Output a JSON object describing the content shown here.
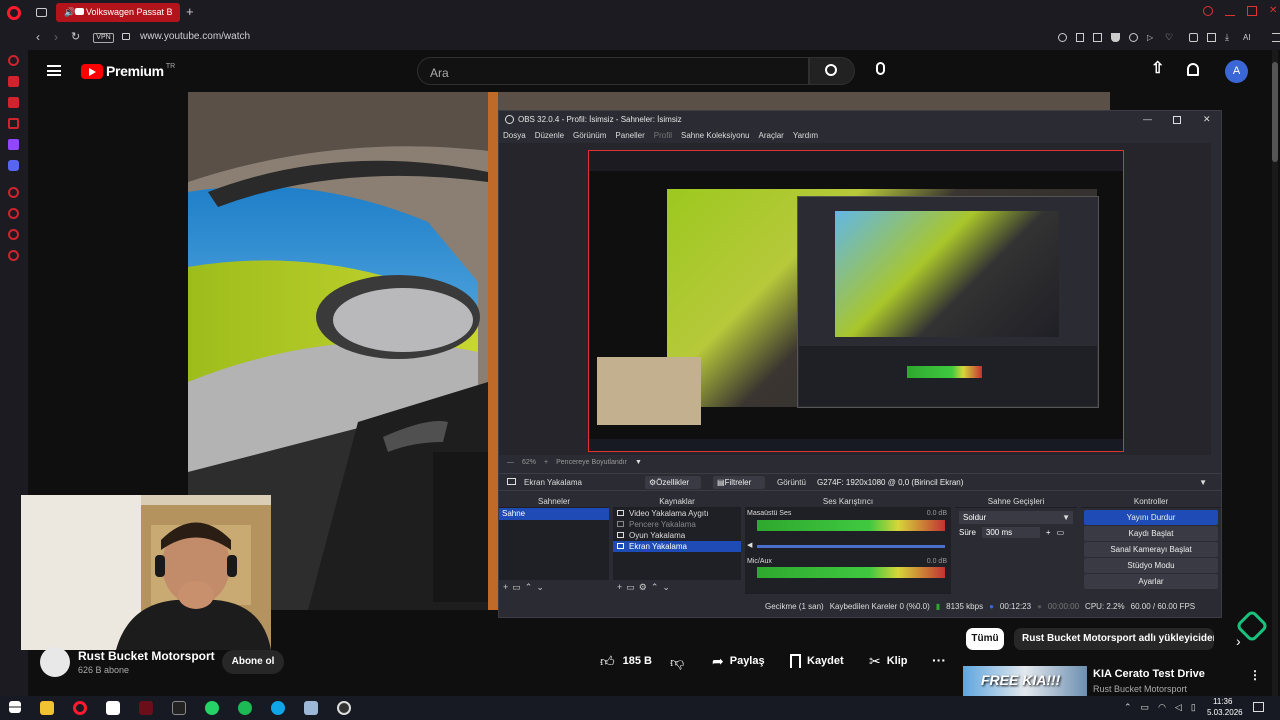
{
  "browser": {
    "tab_title": "Volkswagen Passat B",
    "url": "www.youtube.com/watch",
    "vpn_label": "VPN",
    "ai_label": "AI"
  },
  "youtube": {
    "logo_text": "Premium",
    "logo_sup": "TR",
    "search_placeholder": "Ara",
    "avatar_letter": "A",
    "channel_name": "Rust Bucket Motorsport",
    "subscribers": "626 B abone",
    "subscribe_label": "Abone ol",
    "like_count": "185 B",
    "share_label": "Paylaş",
    "save_label": "Kaydet",
    "clip_label": "Klip",
    "filter_all": "Tümü",
    "filter_uploader": "Rust Bucket Motorsport adlı yükleyiciden",
    "rec_title": "KIA Cerato Test Drive",
    "rec_channel": "Rust Bucket Motorsport",
    "rec_thumb_text": "FREE KIA!!!"
  },
  "obs": {
    "title": "OBS 32.0.4 - Profil: İsimsiz - Sahneler: İsimsiz",
    "menu": [
      "Dosya",
      "Düzenle",
      "Görünüm",
      "Paneller",
      "Profil",
      "Sahne Koleksiyonu",
      "Araçlar",
      "Yardım"
    ],
    "zoom": "62%",
    "fit_label": "Pencereye Boyutlandır",
    "source_name": "Ekran Yakalama",
    "properties_label": "Özellikler",
    "filters_label": "Filtreler",
    "display_label": "Görüntü",
    "display_value": "G274F: 1920x1080 @ 0,0 (Birincil Ekran)",
    "panels": {
      "scenes": "Sahneler",
      "sources": "Kaynaklar",
      "mixer": "Ses Karıştırıcı",
      "transitions": "Sahne Geçişleri",
      "controls": "Kontroller"
    },
    "scene_item": "Sahne",
    "sources": [
      "Video Yakalama Aygıtı",
      "Pencere Yakalama",
      "Oyun Yakalama",
      "Ekran Yakalama"
    ],
    "mixer": {
      "track1": "Masaüstü Ses",
      "track1_db": "0.0 dB",
      "track2": "Mic/Aux",
      "track2_db": "0.0 dB"
    },
    "transition": "Soldur",
    "duration_label": "Süre",
    "duration_value": "300 ms",
    "controls": [
      "Yayını Durdur",
      "Kaydı Başlat",
      "Sanal Kamerayı Başlat",
      "Stüdyo Modu",
      "Ayarlar"
    ],
    "status": {
      "delay": "Gecikme (1 san)",
      "dropped": "Kaybedilen Kareler 0 (%0.0)",
      "bitrate": "8135 kbps",
      "stream_time": "00:12:23",
      "rec_time": "00:00:00",
      "cpu": "CPU: 2.2%",
      "fps": "60.00 / 60.00 FPS"
    }
  },
  "taskbar": {
    "time": "11:36",
    "date": "5.03.2026"
  },
  "colors": {
    "opera_red": "#ff1b2d",
    "yt_red": "#ff0000",
    "obs_bg": "#2b2b33",
    "obs_select": "#1e4bb5"
  }
}
